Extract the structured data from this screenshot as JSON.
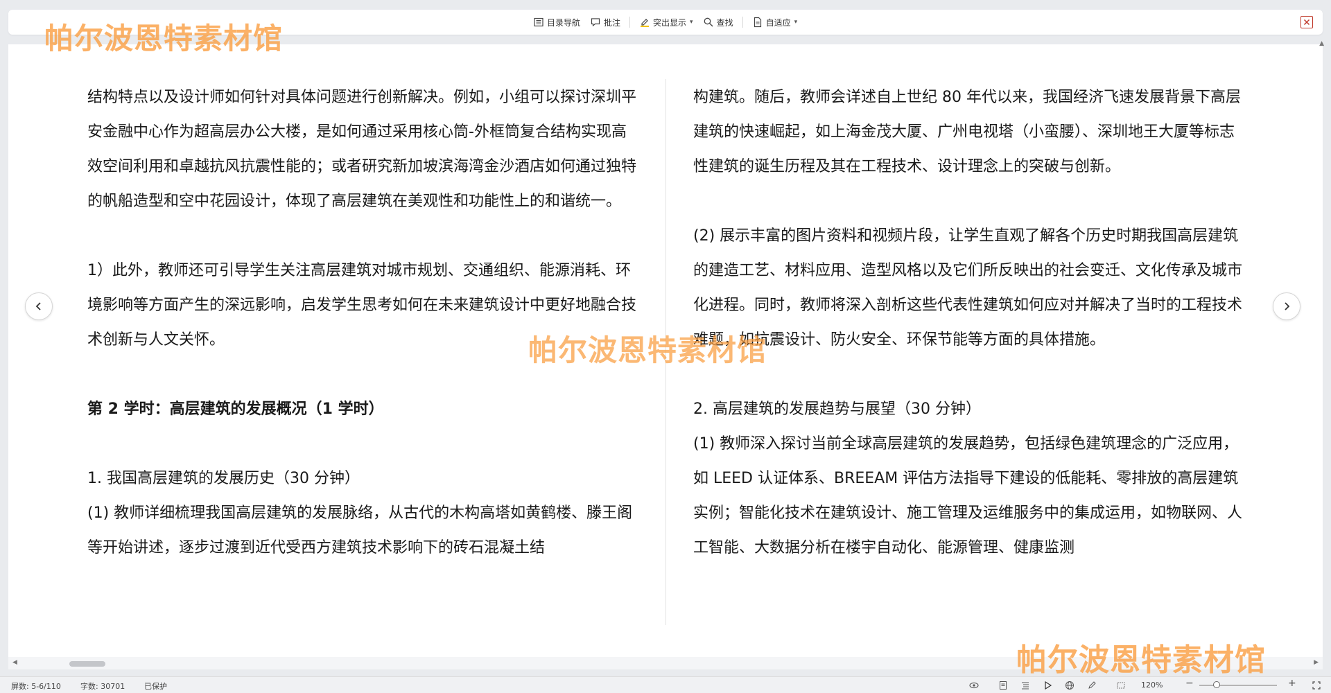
{
  "toolbar": {
    "toc_label": "目录导航",
    "comment_label": "批注",
    "highlight_label": "突出显示",
    "find_label": "查找",
    "fit_label": "自适应"
  },
  "watermark": {
    "text": "帕尔波恩特素材馆"
  },
  "left_column": {
    "p1": "结构特点以及设计师如何针对具体问题进行创新解决。例如，小组可以探讨深圳平安金融中心作为超高层办公大楼，是如何通过采用核心筒-外框筒复合结构实现高效空间利用和卓越抗风抗震性能的；或者研究新加坡滨海湾金沙酒店如何通过独特的帆船造型和空中花园设计，体现了高层建筑在美观性和功能性上的和谐统一。",
    "p2": "1）此外，教师还可引导学生关注高层建筑对城市规划、交通组织、能源消耗、环境影响等方面产生的深远影响，启发学生思考如何在未来建筑设计中更好地融合技术创新与人文关怀。",
    "heading": "第 2 学时：高层建筑的发展概况（1 学时）",
    "p3": "1.  我国高层建筑的发展历史（30 分钟）",
    "p4": "(1)  教师详细梳理我国高层建筑的发展脉络，从古代的木构高塔如黄鹤楼、滕王阁等开始讲述，逐步过渡到近代受西方建筑技术影响下的砖石混凝土结"
  },
  "right_column": {
    "p1": "构建筑。随后，教师会详述自上世纪 80 年代以来，我国经济飞速发展背景下高层建筑的快速崛起，如上海金茂大厦、广州电视塔（小蛮腰）、深圳地王大厦等标志性建筑的诞生历程及其在工程技术、设计理念上的突破与创新。",
    "p2": "(2)  展示丰富的图片资料和视频片段，让学生直观了解各个历史时期我国高层建筑的建造工艺、材料应用、造型风格以及它们所反映出的社会变迁、文化传承及城市化进程。同时，教师将深入剖析这些代表性建筑如何应对并解决了当时的工程技术难题，如抗震设计、防火安全、环保节能等方面的具体措施。",
    "p3": "2.  高层建筑的发展趋势与展望（30 分钟）",
    "p4": "(1)  教师深入探讨当前全球高层建筑的发展趋势，包括绿色建筑理念的广泛应用，如 LEED 认证体系、BREEAM 评估方法指导下建设的低能耗、零排放的高层建筑实例；智能化技术在建筑设计、施工管理及运维服务中的集成运用，如物联网、人工智能、大数据分析在楼宇自动化、能源管理、健康监测"
  },
  "status": {
    "page": "屏数: 5-6/110",
    "words": "字数: 30701",
    "protect": "已保护",
    "zoom": "120%"
  },
  "colors": {
    "watermark": "#f7a046",
    "close": "#c0392b",
    "background": "#e9ebee"
  }
}
